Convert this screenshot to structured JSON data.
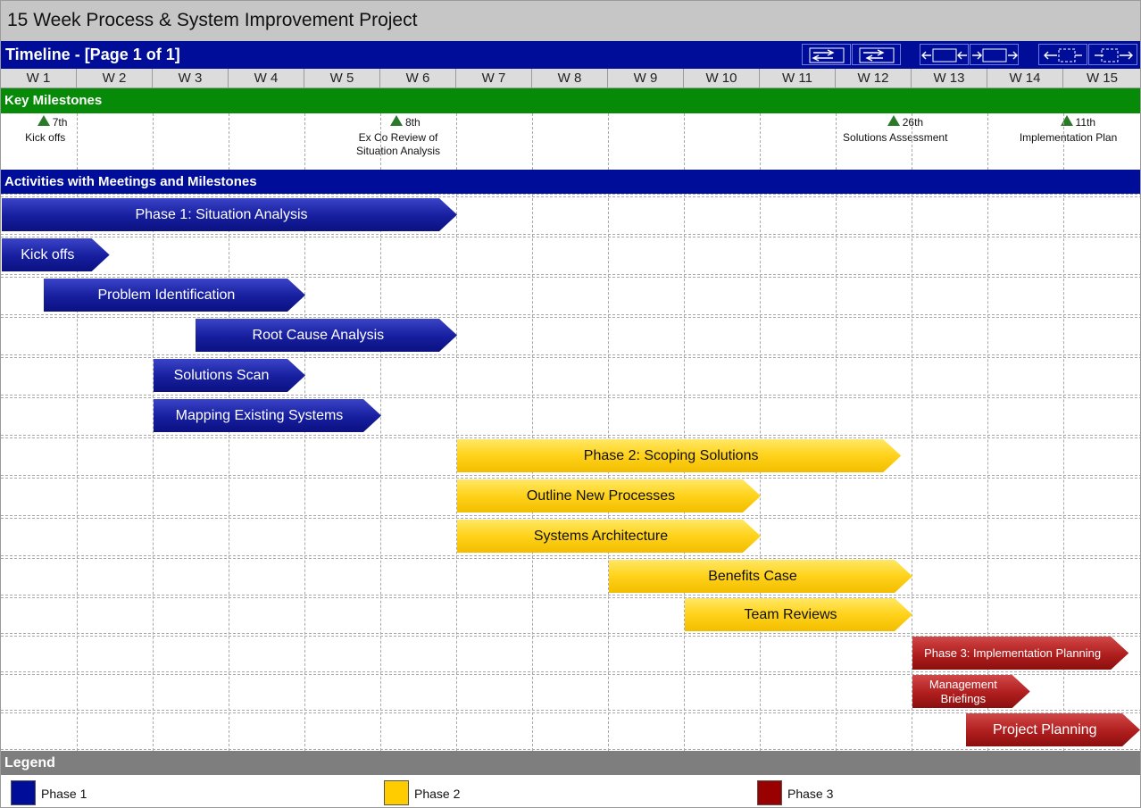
{
  "title": "15 Week Process & System Improvement Project",
  "timeline": {
    "label": "Timeline - [Page 1 of 1]",
    "nav_buttons": [
      "scroll-page-icon",
      "scroll-page-back-icon",
      "collapse-icon",
      "expand-icon",
      "fit-left-icon",
      "fit-right-icon"
    ]
  },
  "weeks": [
    "W 1",
    "W 2",
    "W 3",
    "W 4",
    "W 5",
    "W 6",
    "W 7",
    "W 8",
    "W 9",
    "W 10",
    "W 11",
    "W 12",
    "W 13",
    "W 14",
    "W 15"
  ],
  "milestones": {
    "heading": "Key Milestones",
    "items": [
      {
        "date": "7th",
        "label": "Kick offs",
        "week_position": 1.55
      },
      {
        "date": "8th",
        "label": "Ex Co Review of Situation Analysis",
        "week_position": 6.2
      },
      {
        "date": "26th",
        "label": "Solutions Assessment",
        "week_position": 12.75
      },
      {
        "date": "11th",
        "label": "Implementation Plan",
        "week_position": 15.03
      }
    ]
  },
  "activities": {
    "heading": "Activities with Meetings and Milestones",
    "rows": [
      {
        "label": "Phase 1: Situation Analysis",
        "phase": 1,
        "start_week": 1.0,
        "end_week": 7.0
      },
      {
        "label": "Kick offs",
        "phase": 1,
        "start_week": 1.0,
        "end_week": 2.42
      },
      {
        "label": "Problem Identification",
        "phase": 1,
        "start_week": 1.55,
        "end_week": 5.0
      },
      {
        "label": "Root Cause Analysis",
        "phase": 1,
        "start_week": 3.55,
        "end_week": 7.0
      },
      {
        "label": "Solutions Scan",
        "phase": 1,
        "start_week": 3.0,
        "end_week": 5.0
      },
      {
        "label": "Mapping Existing Systems",
        "phase": 1,
        "start_week": 3.0,
        "end_week": 6.0
      },
      {
        "label": "Phase 2: Scoping Solutions",
        "phase": 2,
        "start_week": 7.0,
        "end_week": 12.85
      },
      {
        "label": "Outline New Processes",
        "phase": 2,
        "start_week": 7.0,
        "end_week": 11.0
      },
      {
        "label": "Systems Architecture",
        "phase": 2,
        "start_week": 7.0,
        "end_week": 11.0
      },
      {
        "label": "Benefits Case",
        "phase": 2,
        "start_week": 9.0,
        "end_week": 13.0
      },
      {
        "label": "Team Reviews",
        "phase": 2,
        "start_week": 10.0,
        "end_week": 13.0
      },
      {
        "label": "Phase 3: Implementation Planning",
        "phase": 3,
        "start_week": 13.0,
        "end_week": 15.85
      },
      {
        "label": "Management Briefings",
        "phase": 3,
        "start_week": 13.0,
        "end_week": 14.55
      },
      {
        "label": "Project Planning",
        "phase": 3,
        "start_week": 13.7,
        "end_week": 16.0
      }
    ]
  },
  "legend": {
    "heading": "Legend",
    "items": [
      {
        "label": "Phase 1",
        "color": "#000d99"
      },
      {
        "label": "Phase 2",
        "color": "#ffcc00"
      },
      {
        "label": "Phase 3",
        "color": "#990000"
      }
    ]
  }
}
